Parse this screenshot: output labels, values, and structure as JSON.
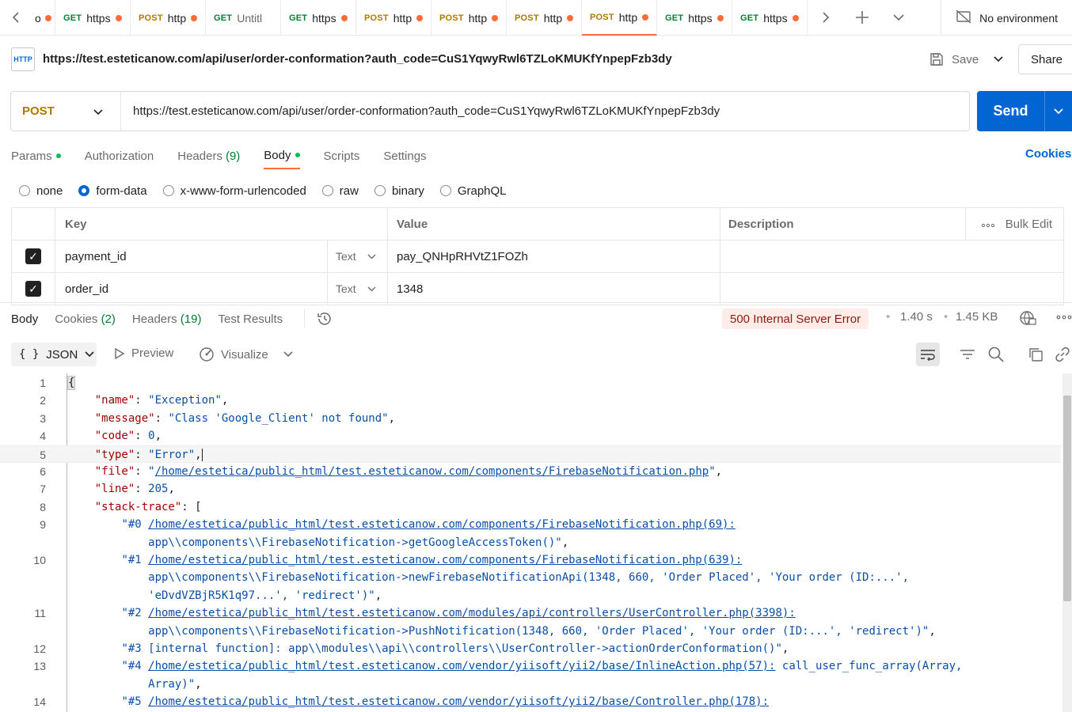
{
  "tabs": [
    {
      "method": "",
      "name": "o",
      "dot": true,
      "first": true
    },
    {
      "method": "GET",
      "name": "https",
      "dot": true
    },
    {
      "method": "POST",
      "name": "http",
      "dot": true
    },
    {
      "method": "GET",
      "name": "Untitl",
      "dot": false
    },
    {
      "method": "GET",
      "name": "https",
      "dot": true
    },
    {
      "method": "POST",
      "name": "http",
      "dot": true
    },
    {
      "method": "POST",
      "name": "http",
      "dot": true
    },
    {
      "method": "POST",
      "name": "http",
      "dot": true
    },
    {
      "method": "POST",
      "name": "http",
      "dot": true,
      "active": true
    },
    {
      "method": "GET",
      "name": "https",
      "dot": true
    },
    {
      "method": "GET",
      "name": "https",
      "dot": true
    }
  ],
  "environment": "No environment",
  "request": {
    "name": "https://test.esteticanow.com/api/user/order-conformation?auth_code=CuS1YqwyRwl6TZLoKMUKfYnpepFzb3dy",
    "method": "POST",
    "url": "https://test.esteticanow.com/api/user/order-conformation?auth_code=CuS1YqwyRwl6TZLoKMUKfYnpepFzb3dy",
    "http_icon": "HTTP",
    "save_label": "Save",
    "share_label": "Share",
    "send_label": "Send"
  },
  "request_tabs": {
    "params": "Params",
    "authorization": "Authorization",
    "headers": "Headers",
    "headers_count": "(9)",
    "body": "Body",
    "scripts": "Scripts",
    "settings": "Settings",
    "cookies": "Cookies"
  },
  "body_types": [
    "none",
    "form-data",
    "x-www-form-urlencoded",
    "raw",
    "binary",
    "GraphQL"
  ],
  "body_type_selected": "form-data",
  "params_table": {
    "headers": {
      "key": "Key",
      "value": "Value",
      "description": "Description",
      "bulk_edit": "Bulk Edit"
    },
    "rows": [
      {
        "key": "payment_id",
        "type": "Text",
        "value": "pay_QNHpRHVtZ1FOZh",
        "description": ""
      },
      {
        "key": "order_id",
        "type": "Text",
        "value": "1348",
        "description": ""
      }
    ]
  },
  "response": {
    "tabs": {
      "body": "Body",
      "cookies": "Cookies",
      "cookies_count": "(2)",
      "headers": "Headers",
      "headers_count": "(19)",
      "test_results": "Test Results"
    },
    "status": "500 Internal Server Error",
    "time": "1.40 s",
    "size": "1.45 KB",
    "format": "JSON",
    "preview": "Preview",
    "visualize": "Visualize"
  },
  "colors": {
    "accent": "#ff6c37",
    "send": "#0265d2",
    "get": "#007f31",
    "post": "#ad7a03",
    "error_bg": "#ffebe7",
    "error_text": "#8e1a10"
  },
  "code_lines": [
    {
      "n": "1",
      "parts": [
        [
          "bracket",
          "{"
        ]
      ]
    },
    {
      "n": "2",
      "parts": [
        [
          "p",
          "    "
        ],
        [
          "k",
          "\"name\""
        ],
        [
          "p",
          ": "
        ],
        [
          "s",
          "\"Exception\""
        ],
        [
          "p",
          ","
        ]
      ]
    },
    {
      "n": "3",
      "parts": [
        [
          "p",
          "    "
        ],
        [
          "k",
          "\"message\""
        ],
        [
          "p",
          ": "
        ],
        [
          "s",
          "\"Class 'Google_Client' not found\""
        ],
        [
          "p",
          ","
        ]
      ]
    },
    {
      "n": "4",
      "parts": [
        [
          "p",
          "    "
        ],
        [
          "k",
          "\"code\""
        ],
        [
          "p",
          ": "
        ],
        [
          "n",
          "0"
        ],
        [
          "p",
          ","
        ]
      ]
    },
    {
      "n": "5",
      "parts": [
        [
          "p",
          "    "
        ],
        [
          "k",
          "\"type\""
        ],
        [
          "p",
          ": "
        ],
        [
          "s",
          "\"Error\""
        ],
        [
          "p",
          ","
        ],
        [
          "cursor",
          ""
        ]
      ],
      "current": true
    },
    {
      "n": "6",
      "parts": [
        [
          "p",
          "    "
        ],
        [
          "k",
          "\"file\""
        ],
        [
          "p",
          ": "
        ],
        [
          "s",
          "\""
        ],
        [
          "u",
          "/home/estetica/public_html/test.esteticanow.com/components/FirebaseNotification.php"
        ],
        [
          "s",
          "\""
        ],
        [
          "p",
          ","
        ]
      ]
    },
    {
      "n": "7",
      "parts": [
        [
          "p",
          "    "
        ],
        [
          "k",
          "\"line\""
        ],
        [
          "p",
          ": "
        ],
        [
          "n",
          "205"
        ],
        [
          "p",
          ","
        ]
      ]
    },
    {
      "n": "8",
      "parts": [
        [
          "p",
          "    "
        ],
        [
          "k",
          "\"stack-trace\""
        ],
        [
          "p",
          ": ["
        ]
      ]
    },
    {
      "n": "9",
      "parts": [
        [
          "p",
          "        "
        ],
        [
          "s",
          "\"#0 "
        ],
        [
          "u",
          "/home/estetica/public_html/test.esteticanow.com/components/FirebaseNotification.php(69):"
        ]
      ]
    },
    {
      "n": "",
      "parts": [
        [
          "s",
          "            app\\\\components\\\\FirebaseNotification->getGoogleAccessToken()\""
        ],
        [
          "p",
          ","
        ]
      ]
    },
    {
      "n": "10",
      "parts": [
        [
          "p",
          "        "
        ],
        [
          "s",
          "\"#1 "
        ],
        [
          "u",
          "/home/estetica/public_html/test.esteticanow.com/components/FirebaseNotification.php(639):"
        ]
      ]
    },
    {
      "n": "",
      "parts": [
        [
          "s",
          "            app\\\\components\\\\FirebaseNotification->newFirebaseNotificationApi(1348, 660, 'Order Placed', 'Your order (ID:...',"
        ]
      ]
    },
    {
      "n": "",
      "parts": [
        [
          "s",
          "            'eDvdVZBjR5K1q97...', 'redirect')\""
        ],
        [
          "p",
          ","
        ]
      ]
    },
    {
      "n": "11",
      "parts": [
        [
          "p",
          "        "
        ],
        [
          "s",
          "\"#2 "
        ],
        [
          "u",
          "/home/estetica/public_html/test.esteticanow.com/modules/api/controllers/UserController.php(3398):"
        ]
      ]
    },
    {
      "n": "",
      "parts": [
        [
          "s",
          "            app\\\\components\\\\FirebaseNotification->PushNotification(1348, 660, 'Order Placed', 'Your order (ID:...', 'redirect')\""
        ],
        [
          "p",
          ","
        ]
      ]
    },
    {
      "n": "12",
      "parts": [
        [
          "p",
          "        "
        ],
        [
          "s",
          "\"#3 [internal function]: app\\\\modules\\\\api\\\\controllers\\\\UserController->actionOrderConformation()\""
        ],
        [
          "p",
          ","
        ]
      ]
    },
    {
      "n": "13",
      "parts": [
        [
          "p",
          "        "
        ],
        [
          "s",
          "\"#4 "
        ],
        [
          "u",
          "/home/estetica/public_html/test.esteticanow.com/vendor/yiisoft/yii2/base/InlineAction.php(57):"
        ],
        [
          "s",
          " call_user_func_array(Array,"
        ]
      ]
    },
    {
      "n": "",
      "parts": [
        [
          "s",
          "            Array)\""
        ],
        [
          "p",
          ","
        ]
      ]
    },
    {
      "n": "14",
      "parts": [
        [
          "p",
          "        "
        ],
        [
          "s",
          "\"#5 "
        ],
        [
          "u",
          "/home/estetica/public_html/test.esteticanow.com/vendor/yiisoft/yii2/base/Controller.php(178):"
        ]
      ]
    }
  ]
}
